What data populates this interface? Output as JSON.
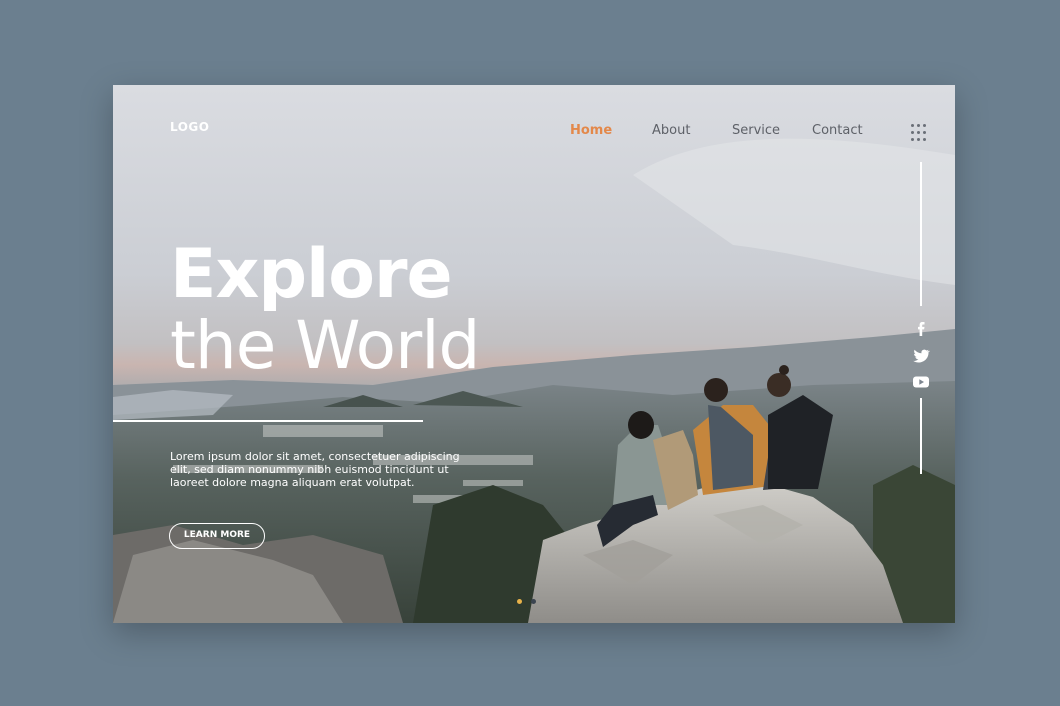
{
  "header": {
    "logo": "LOGO",
    "nav": [
      {
        "label": "Home",
        "active": true
      },
      {
        "label": "About",
        "active": false
      },
      {
        "label": "Service",
        "active": false
      },
      {
        "label": "Contact",
        "active": false
      }
    ],
    "menu_icon": "grid-dots-icon"
  },
  "hero": {
    "title_line1": "Explore",
    "title_line2": "the World",
    "paragraph_lines": [
      "Lorem ipsum dolor sit amet, consectetuer adipiscing",
      "elit, sed diam nonummy nibh euismod tincidunt ut",
      "laoreet dolore magna aliquam erat volutpat."
    ],
    "button_label": "LEARN MORE"
  },
  "social": [
    "facebook-icon",
    "twitter-icon",
    "youtube-icon"
  ],
  "slider": {
    "total": 2,
    "active_index": 0
  },
  "colors": {
    "accent": "#e3884a",
    "background": "#6b7f8f",
    "nav_text": "#5e6168",
    "white": "#ffffff"
  }
}
